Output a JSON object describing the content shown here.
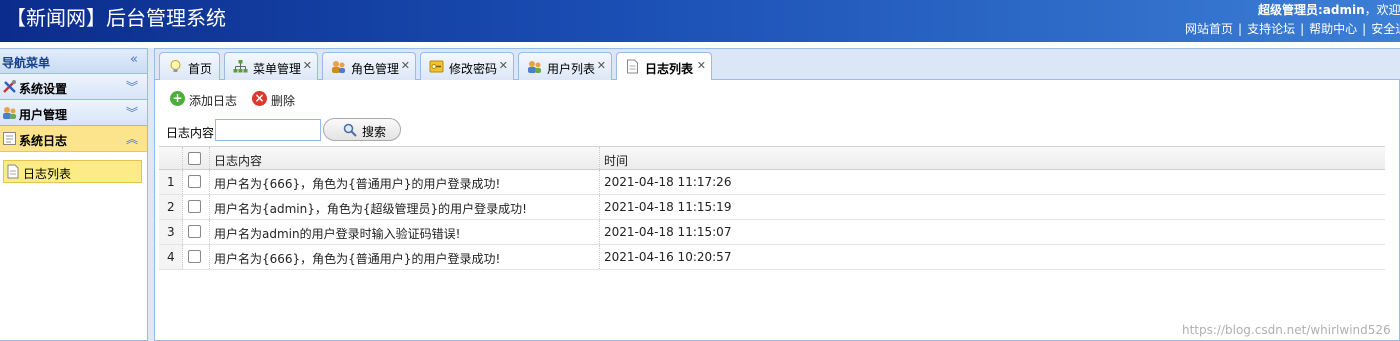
{
  "header": {
    "title": "【新闻网】后台管理系统",
    "user_label": "超级管理员:admin",
    "greeting": "，欢迎您",
    "links": [
      "网站首页",
      "支持论坛",
      "帮助中心",
      "安全退出"
    ],
    "bg_color": "#1b4fb4"
  },
  "nav": {
    "title": "导航菜单",
    "sections": [
      {
        "label": "系统设置",
        "icon": "tools-icon",
        "active": false
      },
      {
        "label": "用户管理",
        "icon": "users-icon",
        "active": false
      },
      {
        "label": "系统日志",
        "icon": "log-icon",
        "active": true
      }
    ],
    "subitems": [
      {
        "label": "日志列表",
        "icon": "document-icon"
      }
    ]
  },
  "tabs": [
    {
      "label": "首页",
      "icon": "bulb-icon",
      "closable": false,
      "active": false
    },
    {
      "label": "菜单管理",
      "icon": "sitemap-icon",
      "closable": true,
      "active": false
    },
    {
      "label": "角色管理",
      "icon": "role-icon",
      "closable": true,
      "active": false
    },
    {
      "label": "修改密码",
      "icon": "password-icon",
      "closable": true,
      "active": false
    },
    {
      "label": "用户列表",
      "icon": "user-list-icon",
      "closable": true,
      "active": false
    },
    {
      "label": "日志列表",
      "icon": "document-icon",
      "closable": true,
      "active": true
    }
  ],
  "toolbar": {
    "add_label": "添加日志",
    "delete_label": "删除",
    "search_label": "日志内容:",
    "search_value": "",
    "search_button": "搜索"
  },
  "grid": {
    "columns": [
      "日志内容",
      "时间"
    ],
    "rows": [
      {
        "num": "1",
        "content": "用户名为{666}，角色为{普通用户}的用户登录成功!",
        "time": "2021-04-18 11:17:26"
      },
      {
        "num": "2",
        "content": "用户名为{admin}，角色为{超级管理员}的用户登录成功!",
        "time": "2021-04-18 11:15:19"
      },
      {
        "num": "3",
        "content": "用户名为admin的用户登录时输入验证码错误!",
        "time": "2021-04-18 11:15:07"
      },
      {
        "num": "4",
        "content": "用户名为{666}，角色为{普通用户}的用户登录成功!",
        "time": "2021-04-16 10:20:57"
      }
    ]
  },
  "watermark": "https://blog.csdn.net/whirlwind526"
}
